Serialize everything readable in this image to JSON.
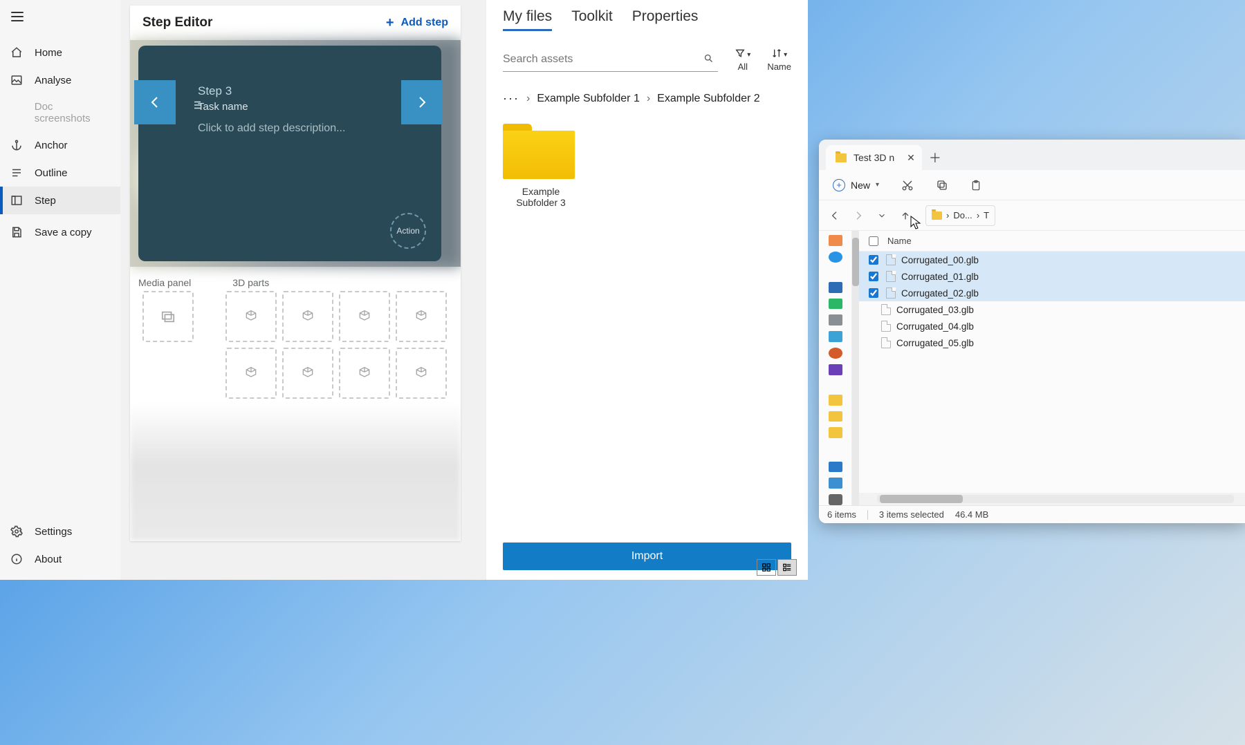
{
  "sidebar": {
    "items": [
      {
        "label": "Home"
      },
      {
        "label": "Analyse"
      },
      {
        "label": "Doc screenshots"
      },
      {
        "label": "Anchor"
      },
      {
        "label": "Outline"
      },
      {
        "label": "Step"
      },
      {
        "label": "Save a copy"
      }
    ],
    "bottom": {
      "settings": "Settings",
      "about": "About"
    }
  },
  "step_editor": {
    "title": "Step Editor",
    "add_step_label": "Add step",
    "step": {
      "number_label": "Step 3",
      "task_label": "Task name",
      "description_placeholder": "Click to add step description...",
      "action_label": "Action"
    },
    "panels": {
      "media_label": "Media panel",
      "parts_label": "3D parts"
    }
  },
  "assets": {
    "tabs": {
      "my_files": "My files",
      "toolkit": "Toolkit",
      "properties": "Properties"
    },
    "search_placeholder": "Search assets",
    "filter": {
      "label": "All"
    },
    "sort": {
      "label": "Name"
    },
    "breadcrumb": {
      "item1": "Example Subfolder 1",
      "item2": "Example Subfolder 2"
    },
    "folder_label": "Example Subfolder 3",
    "import_label": "Import"
  },
  "explorer": {
    "tab_title": "Test 3D n",
    "new_label": "New",
    "address": {
      "segment1": "Do...",
      "segment2": "T"
    },
    "name_col": "Name",
    "files": [
      {
        "name": "Corrugated_00.glb",
        "selected": true
      },
      {
        "name": "Corrugated_01.glb",
        "selected": true
      },
      {
        "name": "Corrugated_02.glb",
        "selected": true
      },
      {
        "name": "Corrugated_03.glb",
        "selected": false
      },
      {
        "name": "Corrugated_04.glb",
        "selected": false
      },
      {
        "name": "Corrugated_05.glb",
        "selected": false
      }
    ],
    "status": {
      "count": "6 items",
      "selection": "3 items selected",
      "size": "46.4 MB"
    }
  }
}
